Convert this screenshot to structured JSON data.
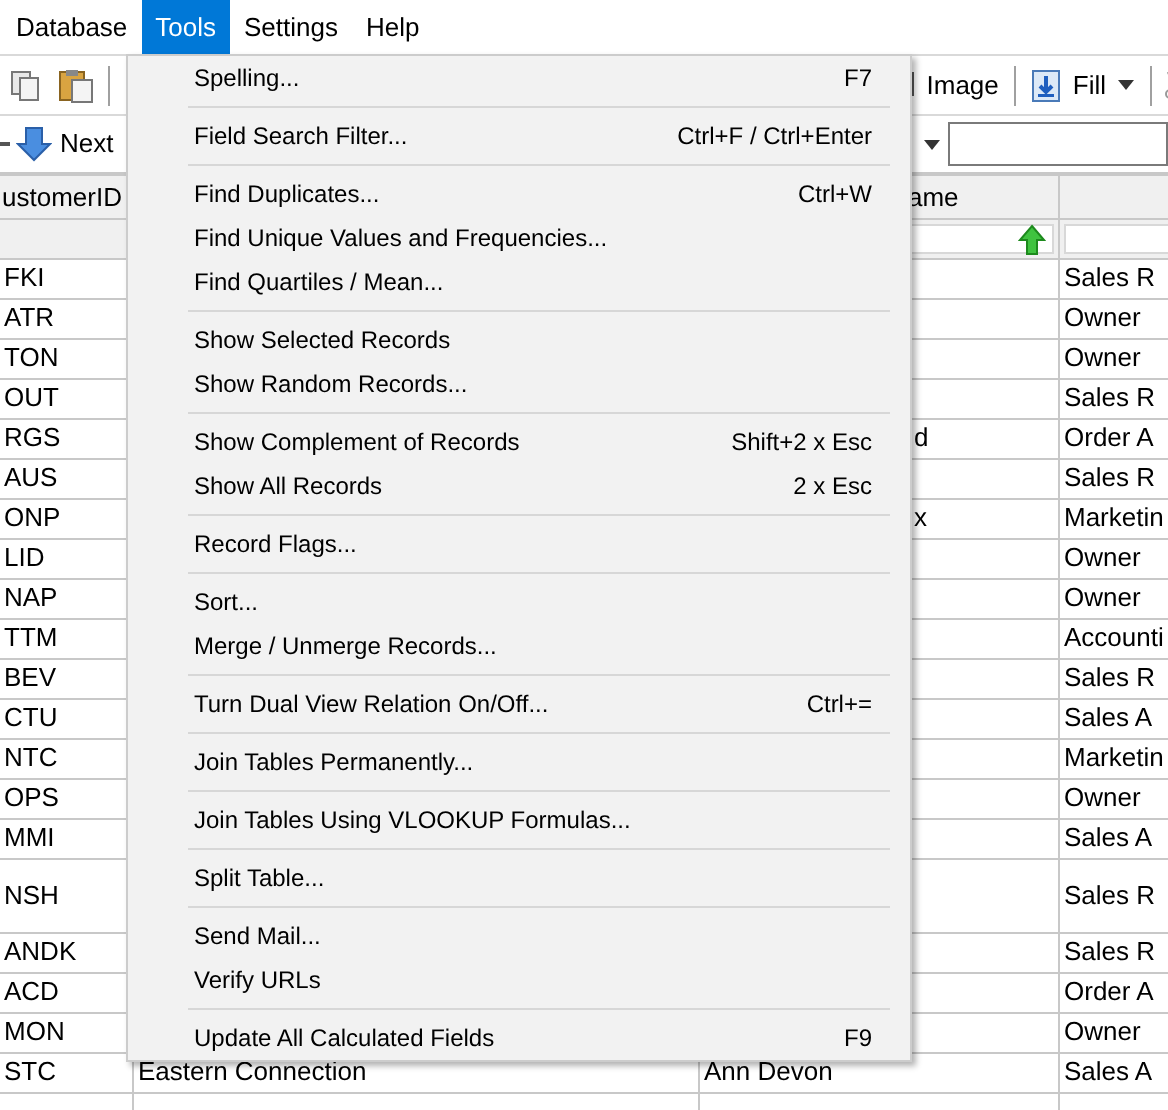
{
  "menu_bar": [
    {
      "label": "Database",
      "selected": false
    },
    {
      "label": "Tools",
      "selected": true
    },
    {
      "label": "Settings",
      "selected": false
    },
    {
      "label": "Help",
      "selected": false
    }
  ],
  "toolbar": {
    "image_button": "Image",
    "fill_button": "Fill"
  },
  "navigation": {
    "next_button": "Next"
  },
  "table": {
    "columns": [
      {
        "label": "ustomerID"
      },
      {},
      {
        "label": "ame",
        "sorted_ascending": true
      },
      {}
    ],
    "rows": [
      {
        "cells": [
          "FKI",
          null,
          null,
          "Sales R"
        ]
      },
      {
        "cells": [
          "ATR",
          null,
          null,
          "Owner"
        ]
      },
      {
        "cells": [
          "TON",
          null,
          null,
          "Owner"
        ]
      },
      {
        "cells": [
          "OUT",
          null,
          null,
          "Sales R"
        ]
      },
      {
        "cells": [
          "RGS",
          null,
          "d",
          "Order A"
        ]
      },
      {
        "cells": [
          "AUS",
          null,
          null,
          "Sales R"
        ]
      },
      {
        "cells": [
          "ONP",
          null,
          "x",
          "Marketin"
        ]
      },
      {
        "cells": [
          "LID",
          null,
          null,
          "Owner"
        ]
      },
      {
        "cells": [
          "NAP",
          null,
          null,
          "Owner"
        ]
      },
      {
        "cells": [
          "TTM",
          null,
          null,
          "Accounti"
        ]
      },
      {
        "cells": [
          "BEV",
          null,
          null,
          "Sales R"
        ]
      },
      {
        "cells": [
          "CTU",
          null,
          null,
          "Sales A"
        ]
      },
      {
        "cells": [
          "NTC",
          null,
          null,
          "Marketin"
        ]
      },
      {
        "cells": [
          "OPS",
          null,
          null,
          "Owner"
        ]
      },
      {
        "cells": [
          "MMI",
          null,
          null,
          "Sales A"
        ]
      },
      {
        "cells": [
          "NSH",
          null,
          null,
          "Sales R"
        ],
        "tall": true
      },
      {
        "cells": [
          "ANDK",
          null,
          null,
          "Sales R"
        ]
      },
      {
        "cells": [
          "ACD",
          null,
          null,
          "Order A"
        ]
      },
      {
        "cells": [
          "MON",
          null,
          null,
          "Owner"
        ]
      },
      {
        "cells": [
          "STC",
          "Eastern Connection",
          "Ann Devon",
          "Sales A"
        ]
      }
    ]
  },
  "tools_menu": {
    "groups": [
      [
        {
          "label": "Spelling...",
          "shortcut": "F7"
        }
      ],
      [
        {
          "label": "Field Search Filter...",
          "shortcut": "Ctrl+F / Ctrl+Enter"
        }
      ],
      [
        {
          "label": "Find Duplicates...",
          "shortcut": "Ctrl+W"
        },
        {
          "label": "Find Unique Values and Frequencies..."
        },
        {
          "label": "Find Quartiles / Mean..."
        }
      ],
      [
        {
          "label": "Show Selected Records"
        },
        {
          "label": "Show Random Records..."
        }
      ],
      [
        {
          "label": "Show Complement of Records",
          "shortcut": "Shift+2 x Esc"
        },
        {
          "label": "Show All Records",
          "shortcut": "2 x Esc"
        }
      ],
      [
        {
          "label": "Record Flags..."
        }
      ],
      [
        {
          "label": "Sort..."
        },
        {
          "label": "Merge / Unmerge Records..."
        }
      ],
      [
        {
          "label": "Turn Dual View Relation On/Off...",
          "shortcut": "Ctrl+="
        }
      ],
      [
        {
          "label": "Join Tables Permanently..."
        }
      ],
      [
        {
          "label": "Join Tables Using VLOOKUP Formulas..."
        }
      ],
      [
        {
          "label": "Split Table..."
        }
      ],
      [
        {
          "label": "Send Mail..."
        },
        {
          "label": "Verify URLs"
        }
      ],
      [
        {
          "label": "Update All Calculated Fields",
          "shortcut": "F9"
        }
      ]
    ]
  }
}
